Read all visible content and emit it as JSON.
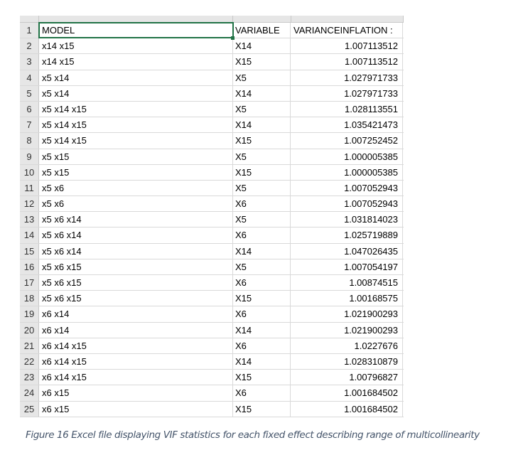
{
  "headers": {
    "model": "MODEL",
    "variable": "VARIABLE",
    "vif": "VARIANCEINFLATION"
  },
  "rows": [
    [
      "x14 x15",
      "X14",
      "1.007113512"
    ],
    [
      "x14 x15",
      "X15",
      "1.007113512"
    ],
    [
      "x5 x14",
      "X5",
      "1.027971733"
    ],
    [
      "x5 x14",
      "X14",
      "1.027971733"
    ],
    [
      "x5 x14 x15",
      "X5",
      "1.028113551"
    ],
    [
      "x5 x14 x15",
      "X14",
      "1.035421473"
    ],
    [
      "x5 x14 x15",
      "X15",
      "1.007252452"
    ],
    [
      "x5 x15",
      "X5",
      "1.000005385"
    ],
    [
      "x5 x15",
      "X15",
      "1.000005385"
    ],
    [
      "x5 x6",
      "X5",
      "1.007052943"
    ],
    [
      "x5 x6",
      "X6",
      "1.007052943"
    ],
    [
      "x5 x6 x14",
      "X5",
      "1.031814023"
    ],
    [
      "x5 x6 x14",
      "X6",
      "1.025719889"
    ],
    [
      "x5 x6 x14",
      "X14",
      "1.047026435"
    ],
    [
      "x5 x6 x15",
      "X5",
      "1.007054197"
    ],
    [
      "x5 x6 x15",
      "X6",
      "1.00874515"
    ],
    [
      "x5 x6 x15",
      "X15",
      "1.00168575"
    ],
    [
      "x6 x14",
      "X6",
      "1.021900293"
    ],
    [
      "x6 x14",
      "X14",
      "1.021900293"
    ],
    [
      "x6 x14 x15",
      "X6",
      "1.0227676"
    ],
    [
      "x6 x14 x15",
      "X14",
      "1.028310879"
    ],
    [
      "x6 x14 x15",
      "X15",
      "1.00796827"
    ],
    [
      "x6 x15",
      "X6",
      "1.001684502"
    ],
    [
      "x6 x15",
      "X15",
      "1.001684502"
    ]
  ],
  "caption": "Figure 16  Excel file displaying VIF statistics for each fixed effect describing range of multicollinearity"
}
